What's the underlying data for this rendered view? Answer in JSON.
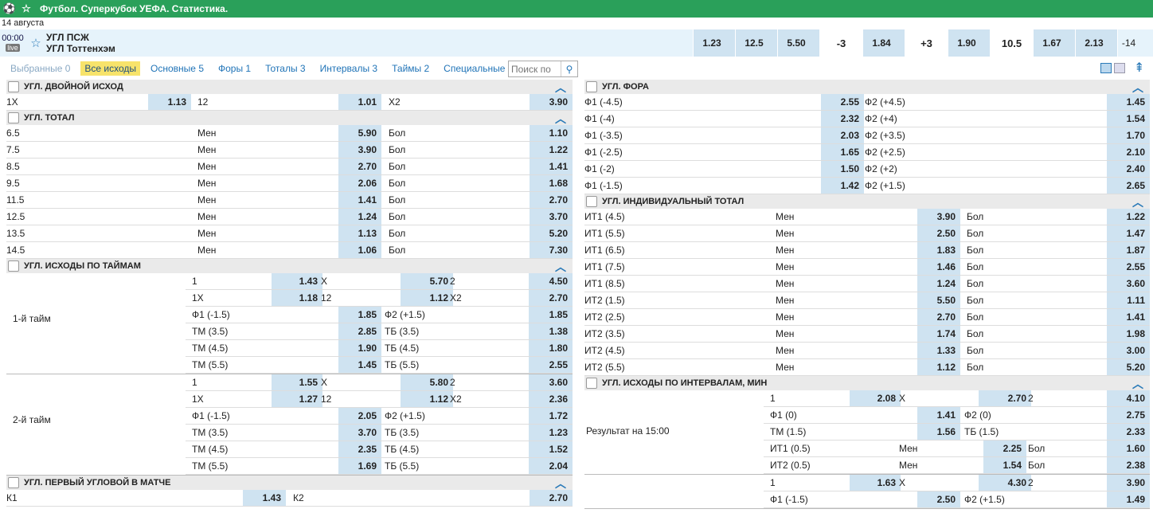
{
  "header": {
    "title": "Футбол. Суперкубок УЕФА. Статистика.",
    "date": "14 августа"
  },
  "match": {
    "time": "00:00",
    "live": "live",
    "team1": "УГЛ ПСЖ",
    "team2": "УГЛ Тоттенхэм",
    "cells": [
      {
        "v": "1.23",
        "t": "odd"
      },
      {
        "v": "12.5",
        "t": "odd"
      },
      {
        "v": "5.50",
        "t": "odd"
      },
      {
        "v": "-3",
        "t": "par"
      },
      {
        "v": "1.84",
        "t": "odd"
      },
      {
        "v": "+3",
        "t": "par"
      },
      {
        "v": "1.90",
        "t": "odd"
      },
      {
        "v": "10.5",
        "t": "par"
      },
      {
        "v": "1.67",
        "t": "odd"
      },
      {
        "v": "2.13",
        "t": "odd"
      },
      {
        "v": "-14",
        "t": "last"
      }
    ]
  },
  "filters": [
    {
      "label": "Выбранные 0",
      "state": "dis"
    },
    {
      "label": "Все исходы",
      "state": "sel"
    },
    {
      "label": "Основные 5",
      "state": ""
    },
    {
      "label": "Форы 1",
      "state": ""
    },
    {
      "label": "Тоталы 3",
      "state": ""
    },
    {
      "label": "Интервалы 3",
      "state": ""
    },
    {
      "label": "Таймы 2",
      "state": ""
    },
    {
      "label": "Специальные 4",
      "state": ""
    }
  ],
  "search": {
    "placeholder": "Поиск по"
  },
  "left": {
    "double": {
      "title": "УГЛ. ДВОЙНОЙ ИСХОД",
      "row": [
        "1X",
        "1.13",
        "12",
        "1.01",
        "X2",
        "3.90"
      ]
    },
    "total": {
      "title": "УГЛ. ТОТАЛ",
      "rows": [
        [
          "6.5",
          "Мен",
          "5.90",
          "Бол",
          "1.10"
        ],
        [
          "7.5",
          "Мен",
          "3.90",
          "Бол",
          "1.22"
        ],
        [
          "8.5",
          "Мен",
          "2.70",
          "Бол",
          "1.41"
        ],
        [
          "9.5",
          "Мен",
          "2.06",
          "Бол",
          "1.68"
        ],
        [
          "11.5",
          "Мен",
          "1.41",
          "Бол",
          "2.70"
        ],
        [
          "12.5",
          "Мен",
          "1.24",
          "Бол",
          "3.70"
        ],
        [
          "13.5",
          "Мен",
          "1.13",
          "Бол",
          "5.20"
        ],
        [
          "14.5",
          "Мен",
          "1.06",
          "Бол",
          "7.30"
        ]
      ]
    },
    "halves": {
      "title": "УГЛ. ИСХОДЫ ПО ТАЙМАМ",
      "blocks": [
        {
          "label": "1-й тайм",
          "r3": [
            [
              "1",
              "1.43",
              "X",
              "5.70",
              "2",
              "4.50"
            ],
            [
              "1X",
              "1.18",
              "12",
              "1.12",
              "X2",
              "2.70"
            ]
          ],
          "r2": [
            [
              "Ф1 (-1.5)",
              "1.85",
              "Ф2 (+1.5)",
              "1.85"
            ],
            [
              "ТМ (3.5)",
              "2.85",
              "ТБ (3.5)",
              "1.38"
            ],
            [
              "ТМ (4.5)",
              "1.90",
              "ТБ (4.5)",
              "1.80"
            ],
            [
              "ТМ (5.5)",
              "1.45",
              "ТБ (5.5)",
              "2.55"
            ]
          ]
        },
        {
          "label": "2-й тайм",
          "r3": [
            [
              "1",
              "1.55",
              "X",
              "5.80",
              "2",
              "3.60"
            ],
            [
              "1X",
              "1.27",
              "12",
              "1.12",
              "X2",
              "2.36"
            ]
          ],
          "r2": [
            [
              "Ф1 (-1.5)",
              "2.05",
              "Ф2 (+1.5)",
              "1.72"
            ],
            [
              "ТМ (3.5)",
              "3.70",
              "ТБ (3.5)",
              "1.23"
            ],
            [
              "ТМ (4.5)",
              "2.35",
              "ТБ (4.5)",
              "1.52"
            ],
            [
              "ТМ (5.5)",
              "1.69",
              "ТБ (5.5)",
              "2.04"
            ]
          ]
        }
      ]
    },
    "first": {
      "title": "УГЛ. ПЕРВЫЙ УГЛОВОЙ В МАТЧЕ",
      "row": [
        "К1",
        "1.43",
        "К2",
        "2.70"
      ]
    }
  },
  "right": {
    "fora": {
      "title": "УГЛ. ФОРА",
      "rows": [
        [
          "Ф1 (-4.5)",
          "2.55",
          "Ф2 (+4.5)",
          "1.45"
        ],
        [
          "Ф1 (-4)",
          "2.32",
          "Ф2 (+4)",
          "1.54"
        ],
        [
          "Ф1 (-3.5)",
          "2.03",
          "Ф2 (+3.5)",
          "1.70"
        ],
        [
          "Ф1 (-2.5)",
          "1.65",
          "Ф2 (+2.5)",
          "2.10"
        ],
        [
          "Ф1 (-2)",
          "1.50",
          "Ф2 (+2)",
          "2.40"
        ],
        [
          "Ф1 (-1.5)",
          "1.42",
          "Ф2 (+1.5)",
          "2.65"
        ]
      ]
    },
    "ind": {
      "title": "УГЛ. ИНДИВИДУАЛЬНЫЙ ТОТАЛ",
      "rows": [
        [
          "ИТ1 (4.5)",
          "Мен",
          "3.90",
          "Бол",
          "1.22"
        ],
        [
          "ИТ1 (5.5)",
          "Мен",
          "2.50",
          "Бол",
          "1.47"
        ],
        [
          "ИТ1 (6.5)",
          "Мен",
          "1.83",
          "Бол",
          "1.87"
        ],
        [
          "ИТ1 (7.5)",
          "Мен",
          "1.46",
          "Бол",
          "2.55"
        ],
        [
          "ИТ1 (8.5)",
          "Мен",
          "1.24",
          "Бол",
          "3.60"
        ],
        [
          "ИТ2 (1.5)",
          "Мен",
          "5.50",
          "Бол",
          "1.11"
        ],
        [
          "ИТ2 (2.5)",
          "Мен",
          "2.70",
          "Бол",
          "1.41"
        ],
        [
          "ИТ2 (3.5)",
          "Мен",
          "1.74",
          "Бол",
          "1.98"
        ],
        [
          "ИТ2 (4.5)",
          "Мен",
          "1.33",
          "Бол",
          "3.00"
        ],
        [
          "ИТ2 (5.5)",
          "Мен",
          "1.12",
          "Бол",
          "5.20"
        ]
      ]
    },
    "interval": {
      "title": "УГЛ. ИСХОДЫ ПО ИНТЕРВАЛАМ, МИН",
      "label": "Результат на 15:00",
      "r3": [
        "1",
        "2.08",
        "X",
        "2.70",
        "2",
        "4.10"
      ],
      "r2": [
        [
          "Ф1 (0)",
          "1.41",
          "Ф2 (0)",
          "2.75"
        ],
        [
          "ТМ (1.5)",
          "1.56",
          "ТБ (1.5)",
          "2.33"
        ]
      ],
      "r4": [
        [
          "ИТ1 (0.5)",
          "Мен",
          "2.25",
          "Бол",
          "1.60"
        ],
        [
          "ИТ2 (0.5)",
          "Мен",
          "1.54",
          "Бол",
          "2.38"
        ]
      ],
      "next_r3": [
        "1",
        "1.63",
        "X",
        "4.30",
        "2",
        "3.90"
      ],
      "next_r2": [
        "Ф1 (-1.5)",
        "2.50",
        "Ф2 (+1.5)",
        "1.49"
      ]
    }
  }
}
